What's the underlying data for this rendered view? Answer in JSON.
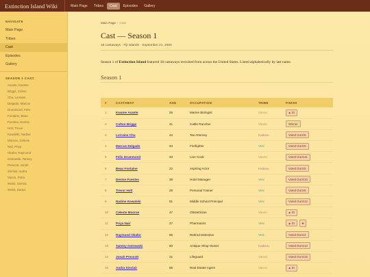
{
  "topbar": {
    "brand": "Extinction Island Wiki",
    "nav": [
      {
        "label": "Main Page",
        "active": false
      },
      {
        "label": "Tribes",
        "active": false
      },
      {
        "label": "Cast",
        "active": true
      },
      {
        "label": "Episodes",
        "active": false
      },
      {
        "label": "Gallery",
        "active": false
      }
    ]
  },
  "sidebar": {
    "nav_heading": "NAVIGATE",
    "nav": [
      {
        "label": "Main Page",
        "active": false
      },
      {
        "label": "Tribes",
        "active": false
      },
      {
        "label": "Cast",
        "active": true
      },
      {
        "label": "Episodes",
        "active": false
      },
      {
        "label": "Gallery",
        "active": false
      }
    ],
    "cast_heading": "SEASON 1 CAST",
    "cast": [
      "Asante, Kwame",
      "Briggs, Colton",
      "Chu, Lorraine",
      "Delgado, Marcus",
      "Drummond, Felix",
      "Fontaine, Beau",
      "Fuentes, Denise",
      "Holt, Trevor",
      "Kowalski, Nadine",
      "Monroe, Celeste",
      "Nair, Priya",
      "Okafor, Raymond",
      "Ostrowski, Tammy",
      "Prescott, Jonah",
      "Sinclair, Audra",
      "Vance, Petra",
      "Webb, Sienna",
      "Webb, Darius"
    ]
  },
  "main": {
    "breadcrumb": {
      "root": "Main Page",
      "separator": "›",
      "current": "Cast"
    },
    "title": "Cast — Season 1",
    "meta": "18 castaways · Fiji Islands · September 21, 2000",
    "intro_before": "Season 1 of ",
    "intro_bold": "Extinction Island",
    "intro_after": " featured 18 castaways recruited from across the United States. Listed alphabetically by last name.",
    "section_title": "Season 1",
    "table": {
      "headers": {
        "num": "#",
        "castaway": "CASTAWAY",
        "age": "AGE",
        "occupation": "OCCUPATION",
        "tribe": "TRIBE",
        "finish": "FINISH"
      },
      "rows": [
        {
          "num": "1",
          "name": "Kwame Asante",
          "age": "26",
          "occupation": "Marine Biologist",
          "tribe": "Vaono",
          "tribe_key": "vaono",
          "finish": [
            "▲ EI"
          ]
        },
        {
          "num": "2",
          "name": "Colton Briggs",
          "age": "41",
          "occupation": "Cattle Rancher",
          "tribe": "Vaono",
          "tribe_key": "vaono",
          "finish": [
            "Winner"
          ],
          "winner": true
        },
        {
          "num": "3",
          "name": "Lorraine Chu",
          "age": "44",
          "occupation": "Tax Attorney",
          "tribe": "Kadavu",
          "tribe_key": "kadavu",
          "finish": [
            "Voted Out E8"
          ]
        },
        {
          "num": "4",
          "name": "Marcus Delgado",
          "age": "34",
          "occupation": "Firefighter",
          "tribe": "Vesi",
          "tribe_key": "vesi",
          "finish": [
            "Voted Out E9"
          ]
        },
        {
          "num": "5",
          "name": "Felix Drummond",
          "age": "33",
          "occupation": "Line Cook",
          "tribe": "Vaono",
          "tribe_key": "vaono",
          "finish": [
            "Voted Out E11"
          ]
        },
        {
          "num": "6",
          "name": "Beau Fontaine",
          "age": "22",
          "occupation": "Aspiring Actor",
          "tribe": "Kadavu",
          "tribe_key": "kadavu",
          "finish": [
            "Voted Out E5"
          ]
        },
        {
          "num": "7",
          "name": "Denise Fuentes",
          "age": "38",
          "occupation": "Hotel Manager",
          "tribe": "Vesi",
          "tribe_key": "vesi",
          "finish": [
            "Voted Out E10"
          ]
        },
        {
          "num": "8",
          "name": "Trevor Holt",
          "age": "29",
          "occupation": "Personal Trainer",
          "tribe": "Vesi",
          "tribe_key": "vesi",
          "finish": [
            "Voted Out E6"
          ]
        },
        {
          "num": "9",
          "name": "Nadine Kowalski",
          "age": "51",
          "occupation": "Middle School Principal",
          "tribe": "Vesi",
          "tribe_key": "vesi",
          "finish": [
            "Voted Out E12"
          ]
        },
        {
          "num": "10",
          "name": "Celeste Monroe",
          "age": "47",
          "occupation": "Obstetrician",
          "tribe": "Vaono",
          "tribe_key": "vaono",
          "finish": [
            "▲ EI"
          ]
        },
        {
          "num": "11",
          "name": "Priya Nair",
          "age": "27",
          "occupation": "Pharmacist",
          "tribe": "Vesi",
          "tribe_key": "vesi",
          "finish": [
            "▲ EI",
            "★"
          ]
        },
        {
          "num": "12",
          "name": "Raymond Okafor",
          "age": "55",
          "occupation": "Retired Detective",
          "tribe": "Vesi",
          "tribe_key": "vesi",
          "finish": [
            "Voted Out E4"
          ]
        },
        {
          "num": "13",
          "name": "Tammy Ostrowski",
          "age": "60",
          "occupation": "Antique Shop Owner",
          "tribe": "Kadavu",
          "tribe_key": "kadavu",
          "finish": [
            "Voted Out E13"
          ]
        },
        {
          "num": "14",
          "name": "Jonah Prescott",
          "age": "21",
          "occupation": "Lifeguard",
          "tribe": "Vaono",
          "tribe_key": "vaono",
          "finish": [
            "Voted Out E15"
          ]
        },
        {
          "num": "15",
          "name": "Audra Sinclair",
          "age": "58",
          "occupation": "Real Estate Agent",
          "tribe": "Vaono",
          "tribe_key": "vaono",
          "finish": [
            "▲ EI"
          ]
        }
      ]
    }
  },
  "colors": {
    "topbar": "#6a2d18",
    "sidebar": "#f6d16c",
    "page": "#fbe9a6",
    "link": "#3a2bb0",
    "vesi": "#4aa39a",
    "kadavu": "#c86a8e",
    "vaono": "#d08a52"
  }
}
